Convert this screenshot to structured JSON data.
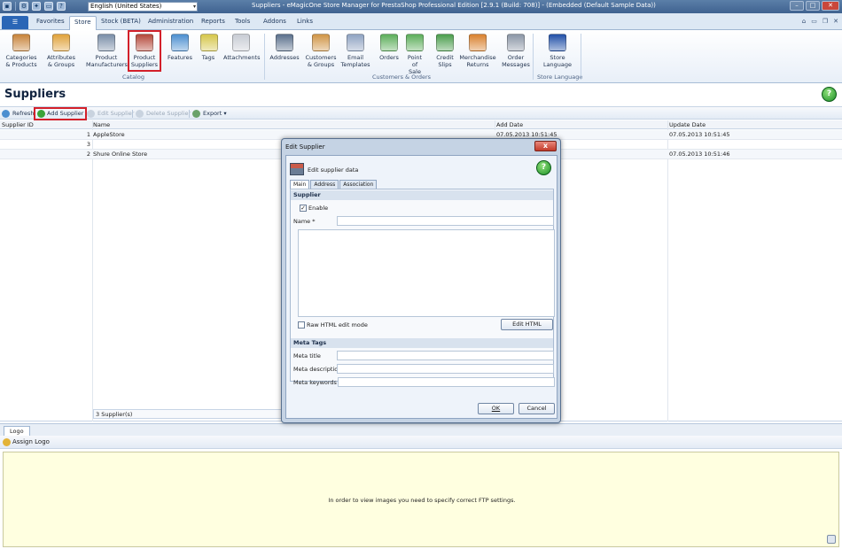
{
  "window": {
    "title": "Suppliers - eMagicOne Store Manager for PrestaShop Professional Edition [2.9.1 (Build: 708)] - (Embedded (Default Sample Data))",
    "language": "English (United States)"
  },
  "ribbon_tabs": {
    "file": "☰",
    "items": [
      "Favorites",
      "Store",
      "Stock (BETA)",
      "Administration",
      "Reports",
      "Tools",
      "Addons",
      "Links"
    ],
    "active": "Store"
  },
  "ribbon": {
    "catalog": {
      "group_label": "Catalog",
      "buttons": [
        {
          "l1": "Categories",
          "l2": "& Products",
          "icon": "box-icon",
          "color": "#c7833a"
        },
        {
          "l1": "Attributes",
          "l2": "& Groups",
          "icon": "attributes-icon",
          "color": "#e0a23a"
        },
        {
          "l1": "Product",
          "l2": "Manufacturers",
          "icon": "factory-icon",
          "color": "#7a8ea8"
        },
        {
          "l1": "Product",
          "l2": "Suppliers",
          "icon": "store-icon",
          "color": "#b5483a"
        },
        {
          "l1": "Features",
          "l2": "",
          "icon": "features-icon",
          "color": "#4c8fd0"
        },
        {
          "l1": "Tags",
          "l2": "",
          "icon": "tag-icon",
          "color": "#d5c64a"
        },
        {
          "l1": "Attachments",
          "l2": "",
          "icon": "paperclip-icon",
          "color": "#c8ccd4"
        }
      ]
    },
    "customers": {
      "group_label": "Customers & Orders",
      "buttons": [
        {
          "l1": "Addresses",
          "l2": "",
          "icon": "address-book-icon",
          "color": "#5a6f8c"
        },
        {
          "l1": "Customers",
          "l2": "& Groups",
          "icon": "customers-icon",
          "color": "#d09546"
        },
        {
          "l1": "Email",
          "l2": "Templates",
          "icon": "email-template-icon",
          "color": "#8fa3c2"
        },
        {
          "l1": "Orders",
          "l2": "",
          "icon": "orders-icon",
          "color": "#5cae5a"
        },
        {
          "l1": "Point",
          "l2": "of Sale",
          "icon": "point-of-sale-icon",
          "color": "#5cae5a"
        },
        {
          "l1": "Credit",
          "l2": "Slips",
          "icon": "credit-slip-icon",
          "color": "#4b9e4d"
        },
        {
          "l1": "Merchandise",
          "l2": "Returns",
          "icon": "returns-icon",
          "color": "#d9812e"
        },
        {
          "l1": "Order",
          "l2": "Messages",
          "icon": "messages-icon",
          "color": "#8b96a6"
        }
      ]
    },
    "language": {
      "group_label": "Store Language",
      "buttons": [
        {
          "l1": "Store",
          "l2": "Language",
          "icon": "language-icon",
          "color": "#2150a8"
        }
      ]
    }
  },
  "page": {
    "title": "Suppliers"
  },
  "toolbar": {
    "refresh": "Refresh",
    "add": "Add Supplier",
    "edit": "Edit Supplier",
    "delete": "Delete Supplier",
    "export": "Export ▾"
  },
  "grid": {
    "columns": [
      "Supplier ID",
      "Name",
      "Add Date",
      "Update Date"
    ],
    "rows": [
      {
        "id": "1",
        "name": "AppleStore",
        "add": "07.05.2013 10:51:45",
        "upd": "07.05.2013 10:51:45"
      },
      {
        "id": "3",
        "name": "",
        "add": "",
        "upd": ""
      },
      {
        "id": "2",
        "name": "Shure Online Store",
        "add": "",
        "upd": "07.05.2013 10:51:46"
      }
    ],
    "count": "3 Supplier(s)"
  },
  "logo_panel": {
    "tab": "Logo",
    "assign": "Assign Logo",
    "message": "In order to view images you need to specify correct FTP settings."
  },
  "dialog": {
    "title": "Edit Supplier",
    "close": "x",
    "header": "Edit supplier data",
    "tabs": [
      "Main",
      "Address",
      "Association"
    ],
    "section_supplier": "Supplier",
    "enable_label": "Enable",
    "enable_checked": "✓",
    "name_label": "Name *",
    "name_value": "",
    "raw_html_label": "Raw HTML edit mode",
    "edit_html": "Edit HTML",
    "section_meta": "Meta Tags",
    "meta_title_label": "Meta title",
    "meta_description_label": "Meta description",
    "meta_keywords_label": "Meta keywords",
    "ok": "OK",
    "cancel": "Cancel"
  },
  "colors": {
    "highlight": "#d3202a",
    "titlebar": "#4a6d98",
    "logo_bg": "#ffffe0"
  }
}
